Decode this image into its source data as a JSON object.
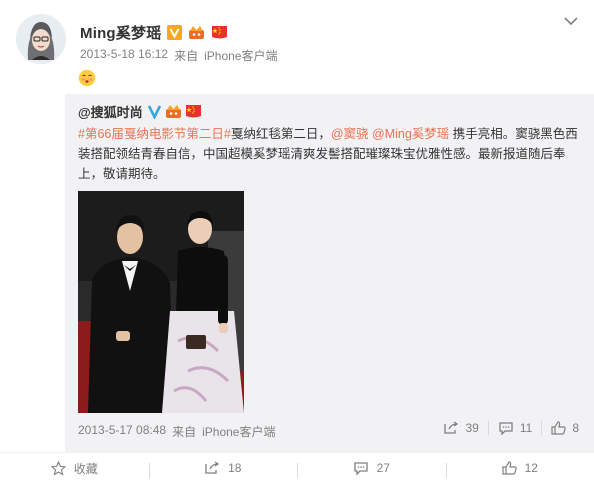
{
  "post": {
    "user_name": "Ming奚梦瑶",
    "timestamp": "2013-5-18 16:12",
    "source_prefix": "来自",
    "source": "iPhone客户端",
    "emoji": "smiling-face-emoji"
  },
  "repost": {
    "author": "@搜狐时尚",
    "topic": "#第66届戛纳电影节第二日#",
    "text_1": "戛纳红毯第二日，",
    "mention_1": "@窦骁",
    "mention_2": "@Ming奚梦瑶",
    "text_2": " 携手亮相。窦骁黑色西装搭配领结青春自信，中国超模奚梦瑶清爽发髻搭配璀璨珠宝优雅性感。最新报道随后奉上，敬请期待。",
    "timestamp": "2013-5-17 08:48",
    "source_prefix": "来自",
    "source": "iPhone客户端",
    "reposts": "39",
    "comments": "11",
    "likes": "8"
  },
  "actions": {
    "favorite_label": "收藏",
    "repost_count": "18",
    "comment_count": "27",
    "like_count": "12"
  },
  "colors": {
    "link": "#eb7350",
    "muted": "#808080",
    "repost_bg": "#f2f2f5",
    "verified_gold": "#f5a623",
    "verified_blue": "#3aa6e0"
  }
}
